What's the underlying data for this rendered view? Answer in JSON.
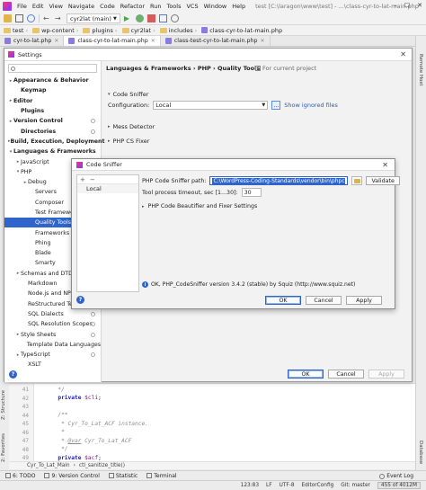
{
  "ide": {
    "menu": [
      "File",
      "Edit",
      "View",
      "Navigate",
      "Code",
      "Refactor",
      "Run",
      "Tools",
      "VCS",
      "Window",
      "Help"
    ],
    "window_title": "test [C:\\laragon\\www\\test] - ...\\class-cyr-to-lat-main.php",
    "branch": "cyr2lat (main)",
    "breadcrumbs": [
      "test",
      "wp-content",
      "plugins",
      "cyr2lat",
      "includes",
      "class-cyr-to-lat-main.php"
    ],
    "tabs": [
      "cyr-to-lat.php",
      "class-cyr-to-lat-main.php",
      "class-test-cyr-to-lat-main.php"
    ],
    "right_strip": [
      "Remote Host",
      "Database"
    ],
    "left_strip": [
      "2: Favorites",
      "Z: Structure"
    ]
  },
  "settings": {
    "title": "Settings",
    "tree": [
      {
        "label": "Appearance & Behavior",
        "indent": 0,
        "arrow": "▸",
        "bold": true
      },
      {
        "label": "Keymap",
        "indent": 1,
        "arrow": "",
        "bold": true
      },
      {
        "label": "Editor",
        "indent": 0,
        "arrow": "▸",
        "bold": true
      },
      {
        "label": "Plugins",
        "indent": 1,
        "arrow": "",
        "bold": true
      },
      {
        "label": "Version Control",
        "indent": 0,
        "arrow": "▸",
        "bold": true,
        "gear": true
      },
      {
        "label": "Directories",
        "indent": 1,
        "arrow": "",
        "bold": true,
        "gear": true
      },
      {
        "label": "Build, Execution, Deployment",
        "indent": 0,
        "arrow": "▸",
        "bold": true
      },
      {
        "label": "Languages & Frameworks",
        "indent": 0,
        "arrow": "▾",
        "bold": true
      },
      {
        "label": "JavaScript",
        "indent": 1,
        "arrow": "▸",
        "gear": true
      },
      {
        "label": "PHP",
        "indent": 1,
        "arrow": "▾",
        "gear": true
      },
      {
        "label": "Debug",
        "indent": 2,
        "arrow": "▸",
        "gear": true
      },
      {
        "label": "Servers",
        "indent": 3,
        "arrow": "",
        "gear": true
      },
      {
        "label": "Composer",
        "indent": 3,
        "arrow": "",
        "gear": true
      },
      {
        "label": "Test Frameworks",
        "indent": 3,
        "arrow": "",
        "gear": true
      },
      {
        "label": "Quality Tools",
        "indent": 3,
        "arrow": "",
        "gear": true,
        "selected": true
      },
      {
        "label": "Frameworks",
        "indent": 3,
        "arrow": "",
        "gear": true
      },
      {
        "label": "Phing",
        "indent": 3,
        "arrow": "",
        "gear": true
      },
      {
        "label": "Blade",
        "indent": 3,
        "arrow": "",
        "gear": true
      },
      {
        "label": "Smarty",
        "indent": 3,
        "arrow": "",
        "gear": true
      },
      {
        "label": "Schemas and DTDs",
        "indent": 1,
        "arrow": "▸",
        "gear": true
      },
      {
        "label": "Markdown",
        "indent": 2,
        "arrow": ""
      },
      {
        "label": "Node.js and NPM",
        "indent": 2,
        "arrow": "",
        "gear": true
      },
      {
        "label": "ReStructured Text",
        "indent": 2,
        "arrow": ""
      },
      {
        "label": "SQL Dialects",
        "indent": 2,
        "arrow": "",
        "gear": true
      },
      {
        "label": "SQL Resolution Scopes",
        "indent": 2,
        "arrow": "",
        "gear": true
      },
      {
        "label": "Style Sheets",
        "indent": 1,
        "arrow": "▸",
        "gear": true
      },
      {
        "label": "Template Data Languages",
        "indent": 2,
        "arrow": "",
        "gear": true
      },
      {
        "label": "TypeScript",
        "indent": 1,
        "arrow": "▸",
        "gear": true
      },
      {
        "label": "XSLT",
        "indent": 2,
        "arrow": ""
      }
    ],
    "breadcrumb": "Languages & Frameworks  ›  PHP  ›  Quality Tools",
    "for_current_project": "For current project",
    "code_sniffer_section": "Code Sniffer",
    "configuration_label": "Configuration:",
    "configuration_value": "Local",
    "dots_label": "...",
    "show_ignored": "Show ignored files",
    "mess_detector": "Mess Detector",
    "php_cs_fixer": "PHP CS Fixer",
    "ok": "OK",
    "cancel": "Cancel",
    "apply": "Apply",
    "help": "?"
  },
  "sniffer": {
    "title": "Code Sniffer",
    "add": "+",
    "remove": "−",
    "list_item": "Local",
    "path_label": "PHP Code Sniffer path:",
    "path_value": "C:\\WordPress-Coding-Standards\\vendor\\bin\\phpcs.bat",
    "validate": "Validate",
    "timeout_label": "Tool process timeout, sec [1...30]:",
    "timeout_value": "30",
    "beautifier": "PHP Code Beautifier and Fixer Settings",
    "status": "OK, PHP_CodeSniffer version 3.4.2 (stable) by Squiz (http://www.squiz.net)",
    "ok": "OK",
    "cancel": "Cancel",
    "apply": "Apply",
    "help": "?"
  },
  "editor": {
    "lines": [
      {
        "n": "41",
        "parts": [
          {
            "t": "      */",
            "c": "cm"
          }
        ]
      },
      {
        "n": "42",
        "parts": [
          {
            "t": "      ",
            "c": ""
          },
          {
            "t": "private",
            "c": "kw"
          },
          {
            "t": " ",
            "c": ""
          },
          {
            "t": "$cli",
            "c": "var"
          },
          {
            "t": ";",
            "c": ""
          }
        ]
      },
      {
        "n": "43",
        "parts": [
          {
            "t": "",
            "c": ""
          }
        ]
      },
      {
        "n": "44",
        "parts": [
          {
            "t": "      /**",
            "c": "cm"
          }
        ]
      },
      {
        "n": "45",
        "parts": [
          {
            "t": "       * Cyr_To_Lat_ACF instance.",
            "c": "cm"
          }
        ]
      },
      {
        "n": "46",
        "parts": [
          {
            "t": "       *",
            "c": "cm"
          }
        ]
      },
      {
        "n": "47",
        "parts": [
          {
            "t": "       * ",
            "c": "cm"
          },
          {
            "t": "@var",
            "c": "tag"
          },
          {
            "t": " Cyr_To_Lat_ACF",
            "c": "cm"
          }
        ]
      },
      {
        "n": "48",
        "parts": [
          {
            "t": "       */",
            "c": "cm"
          }
        ]
      },
      {
        "n": "49",
        "parts": [
          {
            "t": "      ",
            "c": ""
          },
          {
            "t": "private",
            "c": "kw"
          },
          {
            "t": " ",
            "c": ""
          },
          {
            "t": "$acf",
            "c": "var"
          },
          {
            "t": ";",
            "c": ""
          }
        ]
      }
    ],
    "breadcrumb": [
      "Cyr_To_Lat_Main",
      "ctl_sanitize_title()"
    ]
  },
  "bottom": {
    "tools": [
      "6: TODO",
      "9: Version Control",
      "Statistic",
      "Terminal"
    ],
    "event_log": "Event Log",
    "status": [
      "123:83",
      "LF",
      "UTF-8",
      "EditorConfig",
      "Git: master"
    ],
    "memory": "455 of 4012M"
  },
  "colors": {
    "selection": "#2f65ca",
    "link": "#2a5db0",
    "keyword": "#1b1bbd"
  }
}
